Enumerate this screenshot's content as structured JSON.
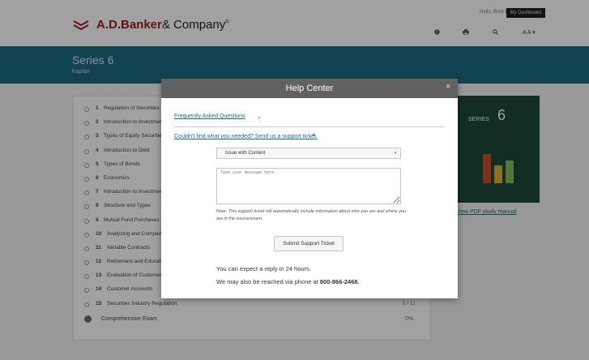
{
  "header": {
    "brand_bold": "A.D.Banker",
    "brand_rest": "& Company",
    "brand_reg": "®",
    "greeting": "Hello, Brett Dossik",
    "dashboard_label": "My Dashboard",
    "font_size_label": "A A ▾",
    "icons": [
      "help-icon",
      "print-icon",
      "search-icon",
      "font-size-icon"
    ]
  },
  "course": {
    "title": "Series 6",
    "subtitle": "Kaplan"
  },
  "chapters": [
    {
      "num": "1",
      "name": "Regulation of Securities",
      "score": ""
    },
    {
      "num": "2",
      "name": "Introduction to Investments",
      "score": ""
    },
    {
      "num": "3",
      "name": "Types of Equity Securities",
      "score": ""
    },
    {
      "num": "4",
      "name": "Introduction to Debt",
      "score": ""
    },
    {
      "num": "5",
      "name": "Types of Bonds",
      "score": ""
    },
    {
      "num": "6",
      "name": "Economics",
      "score": ""
    },
    {
      "num": "7",
      "name": "Introduction to Investment Companies",
      "score": ""
    },
    {
      "num": "8",
      "name": "Structure and Types",
      "score": ""
    },
    {
      "num": "9",
      "name": "Mutual Fund Purchases",
      "score": ""
    },
    {
      "num": "10",
      "name": "Analyzing and Comparing",
      "score": ""
    },
    {
      "num": "11",
      "name": "Variable Contracts",
      "score": ""
    },
    {
      "num": "12",
      "name": "Retirement and Education",
      "score": ""
    },
    {
      "num": "13",
      "name": "Evaluation of Customers",
      "score": ""
    },
    {
      "num": "14",
      "name": "Customer Accounts",
      "score": ""
    },
    {
      "num": "15",
      "name": "Securities Industry Regulation",
      "score": "0 / 11"
    }
  ],
  "comprehensive": {
    "label": "Comprehensive Exam",
    "score": "0%"
  },
  "sidebar": {
    "book_label": "SERIES",
    "book_number": "6",
    "pdf_link": "View PDF study manual"
  },
  "modal": {
    "title": "Help Center",
    "close": "×",
    "faq_label": "Frequently Asked Questions",
    "faq_chevron": "⌄",
    "ticket_label": "Couldn't find what you needed? Send us a support ticket.",
    "ticket_chevron": "˄",
    "issue_selected": "Issue with Content",
    "issue_caret": "▾",
    "message_placeholder": "Type your message here",
    "note": "Note: This support ticket will automatically include information about who you are and where you are in the course/exam.",
    "submit_label": "Submit Support Ticket",
    "expect_text": "You can expect a reply in 24 hours.",
    "phone_prefix": "We may also be reached via phone at ",
    "phone_number": "800-866-2468",
    "phone_suffix": "."
  },
  "colors": {
    "accent": "#1d6a82",
    "brand_red": "#9b1b1b",
    "modal_header": "#616161"
  }
}
